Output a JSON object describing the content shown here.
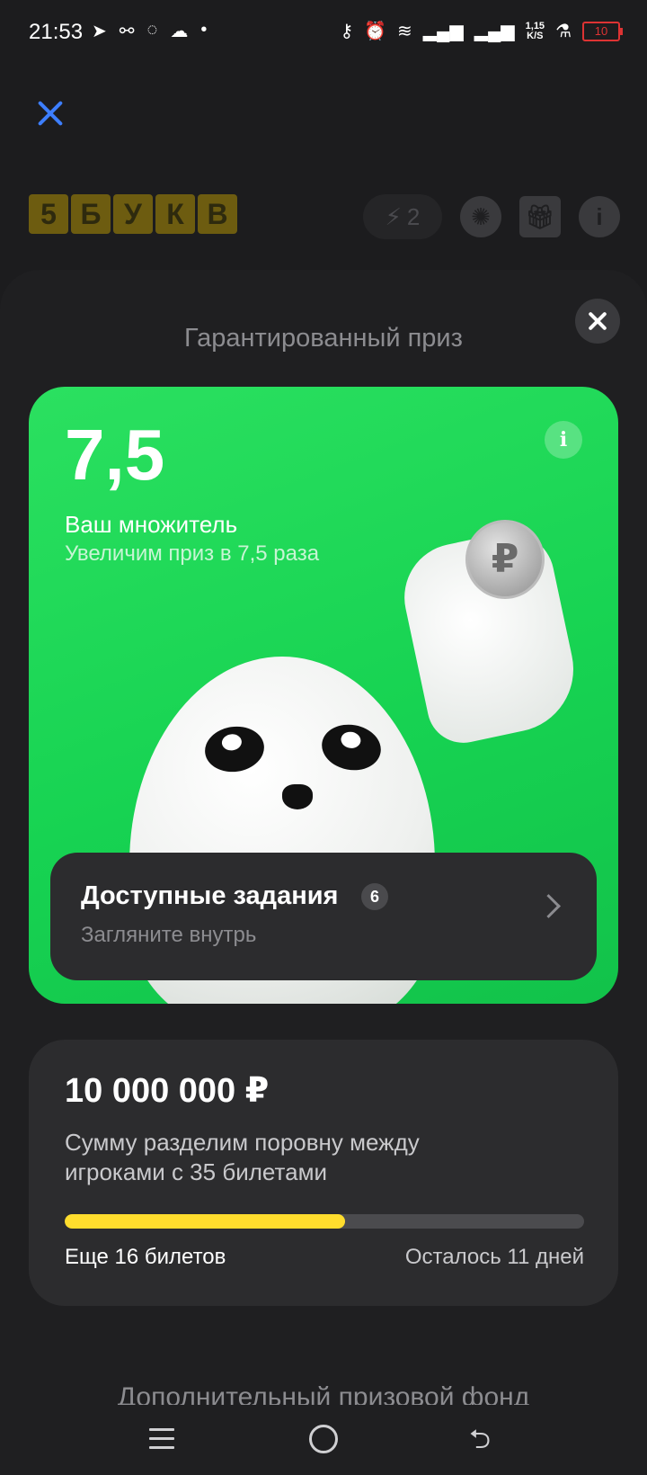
{
  "status_bar": {
    "time": "21:53",
    "left_icons": [
      "telegram-icon",
      "antenna-icon",
      "chat-icon",
      "cloud-icon",
      "dot-icon"
    ],
    "net_speed_value": "1,15",
    "net_speed_unit": "K/S",
    "battery": "10"
  },
  "game": {
    "logo_letters": [
      "5",
      "Б",
      "У",
      "К",
      "В"
    ],
    "energy_count": "2"
  },
  "sheet": {
    "title": "Гарантированный приз"
  },
  "multiplier": {
    "value": "7,5",
    "label": "Ваш множитель",
    "sub": "Увеличим приз в 7,5 раза",
    "info": "i",
    "coin_symbol": "₽"
  },
  "tasks": {
    "title": "Доступные задания",
    "count": "6",
    "sub": "Загляните внутрь"
  },
  "prize": {
    "amount": "10 000 000 ₽",
    "description": "Сумму разделим поровну между игроками с 35 билетами",
    "progress": 0.54,
    "tickets_left": "Еще 16 билетов",
    "days_left": "Осталось 11 дней"
  },
  "extra_fund_title": "Дополнительный призовой фонд",
  "colors": {
    "accent_blue": "#3d7eff",
    "green": "#17d352",
    "progress_yellow": "#ffdd2d"
  }
}
